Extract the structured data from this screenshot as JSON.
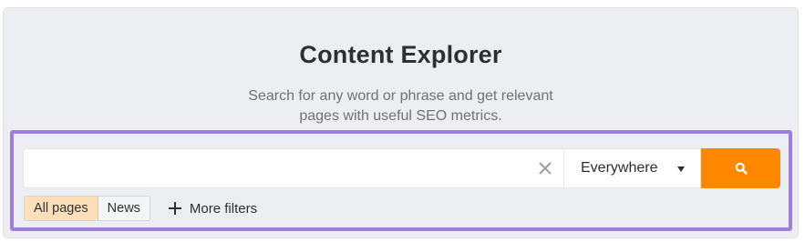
{
  "header": {
    "title": "Content Explorer",
    "subtitle_line1": "Search for any word or phrase and get relevant",
    "subtitle_line2": "pages with useful SEO metrics."
  },
  "search": {
    "value": "",
    "placeholder": "",
    "clear_icon": "close-icon",
    "scope": {
      "selected": "Everywhere",
      "icon": "caret-down-icon"
    },
    "submit_icon": "search-icon",
    "submit_color": "#ff8800"
  },
  "filters": {
    "tabs": [
      {
        "label": "All pages",
        "active": true
      },
      {
        "label": "News",
        "active": false
      }
    ],
    "more_label": "More filters",
    "more_icon": "plus-icon"
  },
  "colors": {
    "accent": "#ff8800",
    "highlight_border": "#9b7fdb",
    "active_tab_bg": "#fde0ba"
  }
}
